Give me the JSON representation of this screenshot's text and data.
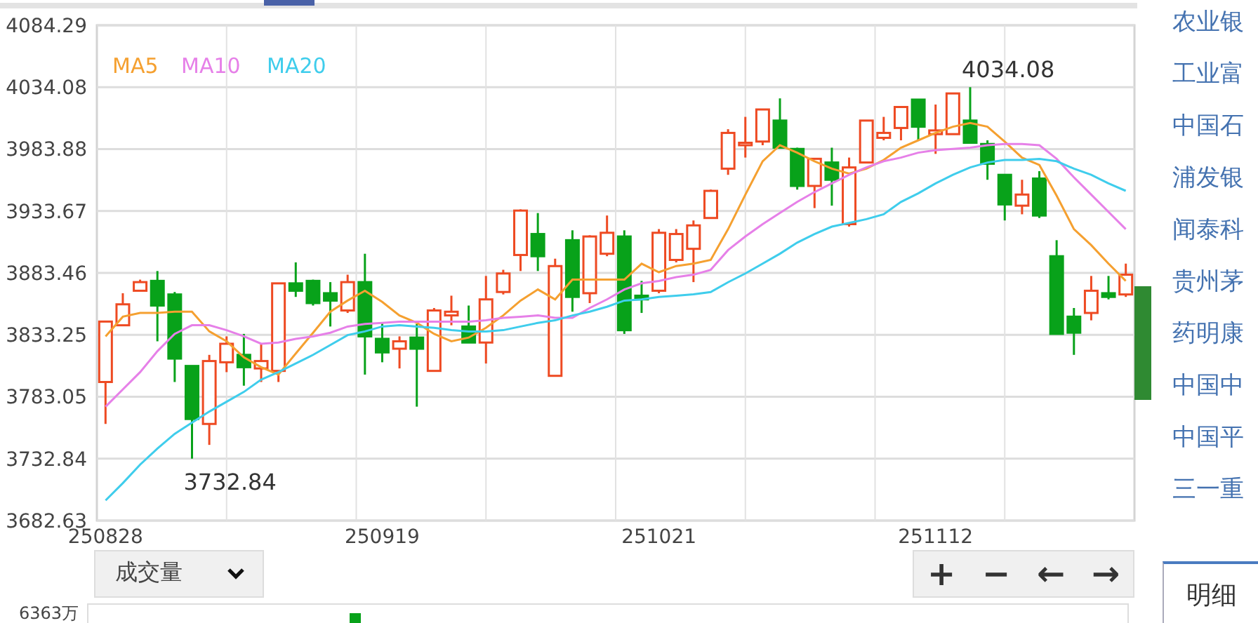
{
  "chart": {
    "chart_data": {
      "type": "candlestick",
      "categories": [
        "250828",
        null,
        null,
        null,
        null,
        null,
        null,
        null,
        null,
        null,
        null,
        null,
        null,
        null,
        null,
        null,
        "250919",
        null,
        null,
        null,
        null,
        null,
        null,
        null,
        null,
        null,
        null,
        null,
        null,
        null,
        null,
        null,
        "251021",
        null,
        null,
        null,
        null,
        null,
        null,
        null,
        null,
        null,
        null,
        null,
        null,
        null,
        null,
        null,
        "251112",
        null,
        null,
        null,
        null,
        null,
        null,
        null,
        null,
        null,
        null,
        null
      ],
      "ylim": [
        3682.63,
        4084.29
      ],
      "grid": true,
      "yticks": [
        3682.63,
        3732.84,
        3783.05,
        3833.25,
        3883.46,
        3933.67,
        3983.88,
        4034.08,
        4084.29
      ],
      "ohlc": [
        [
          3795,
          3844,
          3761,
          3844
        ],
        [
          3841,
          3867,
          3841,
          3858
        ],
        [
          3869,
          3878,
          3869,
          3876
        ],
        [
          3877,
          3885,
          3828,
          3857
        ],
        [
          3866,
          3868,
          3795,
          3814
        ],
        [
          3808,
          3808,
          3732.84,
          3765
        ],
        [
          3761,
          3817,
          3744,
          3812
        ],
        [
          3811,
          3832,
          3803,
          3826
        ],
        [
          3817,
          3834,
          3792,
          3807
        ],
        [
          3806,
          3826,
          3795,
          3812
        ],
        [
          3804,
          3875,
          3795,
          3875
        ],
        [
          3875,
          3892,
          3864,
          3869
        ],
        [
          3877,
          3878,
          3857,
          3859
        ],
        [
          3867,
          3876,
          3840,
          3861
        ],
        [
          3853,
          3882,
          3851,
          3876
        ],
        [
          3876,
          3899,
          3801,
          3832
        ],
        [
          3830,
          3843,
          3811,
          3819
        ],
        [
          3822,
          3832,
          3806,
          3828
        ],
        [
          3831,
          3842,
          3775,
          3822
        ],
        [
          3804,
          3855,
          3804,
          3853
        ],
        [
          3849,
          3865,
          3841,
          3852
        ],
        [
          3840,
          3857,
          3827,
          3827
        ],
        [
          3827,
          3881,
          3810,
          3862
        ],
        [
          3868,
          3886,
          3866,
          3883
        ],
        [
          3898,
          3935,
          3885,
          3934
        ],
        [
          3915,
          3932,
          3885,
          3897
        ],
        [
          3800,
          3895,
          3800,
          3889
        ],
        [
          3910,
          3918,
          3852,
          3864
        ],
        [
          3867,
          3914,
          3859,
          3913
        ],
        [
          3899,
          3930,
          3897,
          3916
        ],
        [
          3913,
          3918,
          3834,
          3837
        ],
        [
          3865,
          3877,
          3851,
          3862
        ],
        [
          3869,
          3919,
          3867,
          3916
        ],
        [
          3894,
          3919,
          3892,
          3915
        ],
        [
          3903,
          3926,
          3876,
          3922
        ],
        [
          3928,
          3951,
          3928,
          3950
        ],
        [
          3968,
          4000,
          3963,
          3997
        ],
        [
          3987,
          4010,
          3977,
          3989
        ],
        [
          3990,
          4016,
          3987,
          4016
        ],
        [
          4007,
          4025,
          3985,
          3985
        ],
        [
          3984,
          3985,
          3951,
          3954
        ],
        [
          3954,
          3976,
          3936,
          3976
        ],
        [
          3973,
          3985,
          3938,
          3959
        ],
        [
          3923,
          3977,
          3921,
          3969
        ],
        [
          3973,
          4007,
          3973,
          4007
        ],
        [
          3993,
          4010,
          3991,
          3997
        ],
        [
          4001,
          4018,
          3991,
          4018
        ],
        [
          4024,
          4024,
          3991,
          4002
        ],
        [
          3996,
          4020,
          3980,
          3999
        ],
        [
          3996,
          4029,
          3996,
          4029
        ],
        [
          4007,
          4034.08,
          3989,
          3989
        ],
        [
          3988,
          3991,
          3959,
          3972
        ],
        [
          3963,
          3963,
          3926,
          3939
        ],
        [
          3938,
          3959,
          3931,
          3947
        ],
        [
          3960,
          3966,
          3928,
          3930
        ],
        [
          3897,
          3910,
          3834,
          3834
        ],
        [
          3848,
          3855,
          3817,
          3835
        ],
        [
          3851,
          3881,
          3845,
          3869
        ],
        [
          3867,
          3881,
          3862,
          3864
        ],
        [
          3866,
          3891,
          3864,
          3882
        ]
      ],
      "series": [
        {
          "name": "MA5",
          "type": "line",
          "color": "#f5a030",
          "values": [
            3832,
            3848,
            3851,
            3851,
            3852,
            3852,
            3836,
            3828,
            3815,
            3807,
            3801,
            3818,
            3835,
            3852,
            3861,
            3869,
            3860,
            3849,
            3843,
            3834,
            3828,
            3831,
            3839,
            3849,
            3861,
            3870,
            3862,
            3878,
            3878,
            3878,
            3878,
            3891,
            3884,
            3889,
            3891,
            3894,
            3919,
            3947,
            3974,
            3987,
            3981,
            3974,
            3968,
            3964,
            3968,
            3975,
            3985,
            3991,
            3997,
            4002,
            4005,
            4002,
            3990,
            3977,
            3971,
            3946,
            3919,
            3906,
            3891,
            3877
          ]
        },
        {
          "name": "MA10",
          "type": "line",
          "color": "#e680e8",
          "values": [
            3775,
            3789,
            3803,
            3820,
            3834,
            3841,
            3841,
            3837,
            3832,
            3826,
            3827,
            3830,
            3832,
            3835,
            3840,
            3842,
            3843,
            3844,
            3844,
            3844,
            3844,
            3844,
            3845,
            3847,
            3848,
            3849,
            3847,
            3847,
            3855,
            3862,
            3870,
            3875,
            3877,
            3880,
            3882,
            3886,
            3902,
            3913,
            3923,
            3932,
            3941,
            3949,
            3956,
            3963,
            3969,
            3974,
            3977,
            3981,
            3983,
            3984,
            3985,
            3987,
            3988,
            3988,
            3987,
            3976,
            3961,
            3947,
            3933,
            3919
          ]
        },
        {
          "name": "MA20",
          "type": "line",
          "color": "#3fcdec",
          "values": [
            3699,
            3713,
            3728,
            3741,
            3753,
            3762,
            3771,
            3779,
            3787,
            3797,
            3803,
            3810,
            3817,
            3825,
            3833,
            3836,
            3840,
            3841,
            3840,
            3839,
            3837,
            3836,
            3836,
            3837,
            3840,
            3843,
            3845,
            3849,
            3852,
            3856,
            3861,
            3862,
            3864,
            3865,
            3866,
            3868,
            3876,
            3883,
            3891,
            3899,
            3908,
            3915,
            3921,
            3924,
            3927,
            3931,
            3941,
            3948,
            3956,
            3963,
            3969,
            3973,
            3975,
            3975,
            3976,
            3974,
            3968,
            3963,
            3956,
            3950
          ]
        }
      ],
      "annotations": [
        "4034.08",
        "3732.84"
      ]
    }
  },
  "indicator_select": {
    "value": "成交量"
  },
  "zoom_controls": [
    "+",
    "−",
    "←",
    "→"
  ],
  "volume_panel": {
    "axis_label": "6363万"
  },
  "stock_list": [
    "农业银",
    "工业富",
    "中国石",
    "浦发银",
    "闻泰科",
    "贵州茅",
    "药明康",
    "中国中",
    "中国平",
    "三一重"
  ],
  "detail_tab": {
    "label": "明细"
  }
}
